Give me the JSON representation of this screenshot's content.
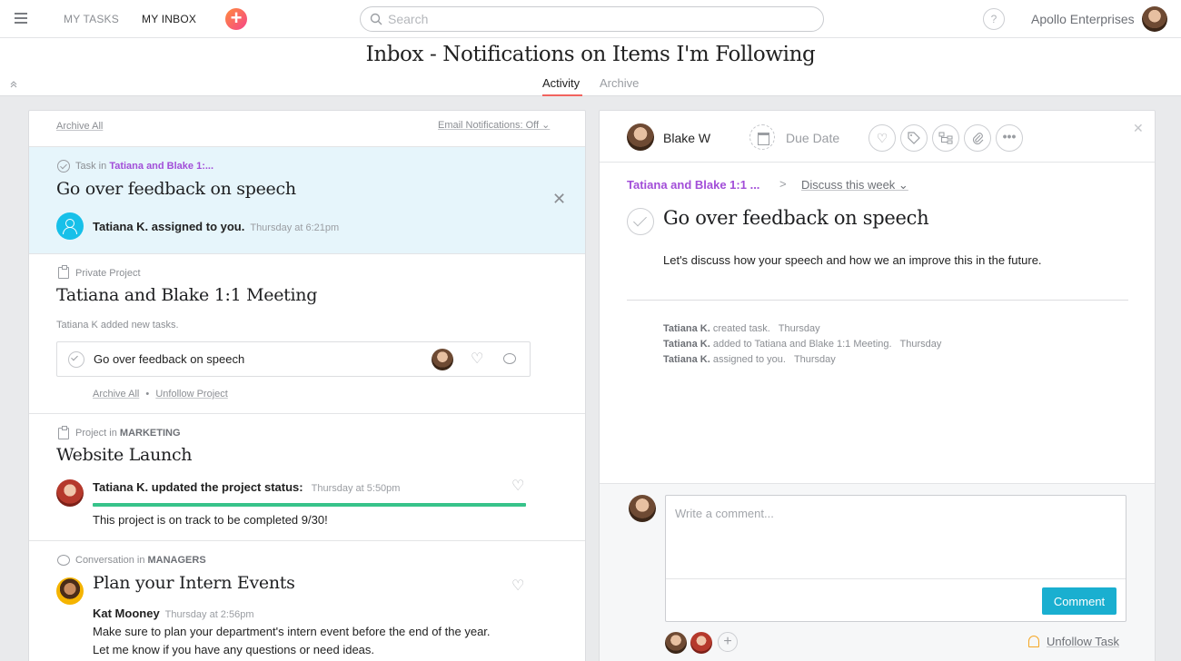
{
  "topbar": {
    "my_tasks": "MY TASKS",
    "my_inbox": "MY INBOX",
    "add_label": "+",
    "search_placeholder": "Search",
    "help_label": "?",
    "org_name": "Apollo Enterprises"
  },
  "header": {
    "title": "Inbox - Notifications on Items I'm Following",
    "tabs": {
      "activity": "Activity",
      "archive": "Archive"
    }
  },
  "inbox": {
    "archive_all": "Archive All",
    "email_notifications": "Email Notifications: Off ⌄",
    "card1": {
      "meta_prefix": "Task in",
      "project": "Tatiana and Blake 1:...",
      "title": "Go over feedback on speech",
      "activity": "Tatiana K. assigned to you.",
      "time": "Thursday at 6:21pm"
    },
    "card2": {
      "meta": "Private Project",
      "title": "Tatiana and Blake 1:1 Meeting",
      "note": "Tatiana K added new tasks.",
      "subtask": "Go over feedback on speech",
      "archive_all": "Archive All",
      "separator": "•",
      "unfollow": "Unfollow Project"
    },
    "card3": {
      "meta_prefix": "Project in",
      "team": "MARKETING",
      "title": "Website Launch",
      "activity": "Tatiana K. updated the project status:",
      "time": "Thursday at 5:50pm",
      "status_text": "This project is on track to be completed 9/30!",
      "status_progress": 1.0
    },
    "card4": {
      "meta_prefix": "Conversation in",
      "team": "MANAGERS",
      "title": "Plan your Intern Events",
      "author": "Kat Mooney",
      "time": "Thursday at 2:56pm",
      "line1": "Make sure to plan your department's intern event before the end of the year.",
      "line2": "Let me know if you have any questions or need ideas."
    }
  },
  "task_pane": {
    "assignee": "Blake W",
    "due_date": "Due Date",
    "breadcrumb_project": "Tatiana and Blake 1:1 ...",
    "breadcrumb_sep": ">",
    "breadcrumb_section": "Discuss this week ⌄",
    "title": "Go over feedback on speech",
    "description": "Let's discuss how your speech and how we an improve this in the future.",
    "stories": [
      {
        "who": "Tatiana K.",
        "what": "created task.",
        "when": "Thursday"
      },
      {
        "who": "Tatiana K.",
        "what": "added to Tatiana and Blake 1:1 Meeting.",
        "when": "Thursday"
      },
      {
        "who": "Tatiana K.",
        "what": "assigned to you.",
        "when": "Thursday"
      }
    ],
    "comment_placeholder": "Write a comment...",
    "comment_button": "Comment",
    "add_follower": "+",
    "unfollow": "Unfollow Task"
  },
  "colors": {
    "accent": "#1aafd0",
    "project_purple": "#a24ed8",
    "status_green": "#37c38a",
    "tab_red": "#f1635f"
  }
}
